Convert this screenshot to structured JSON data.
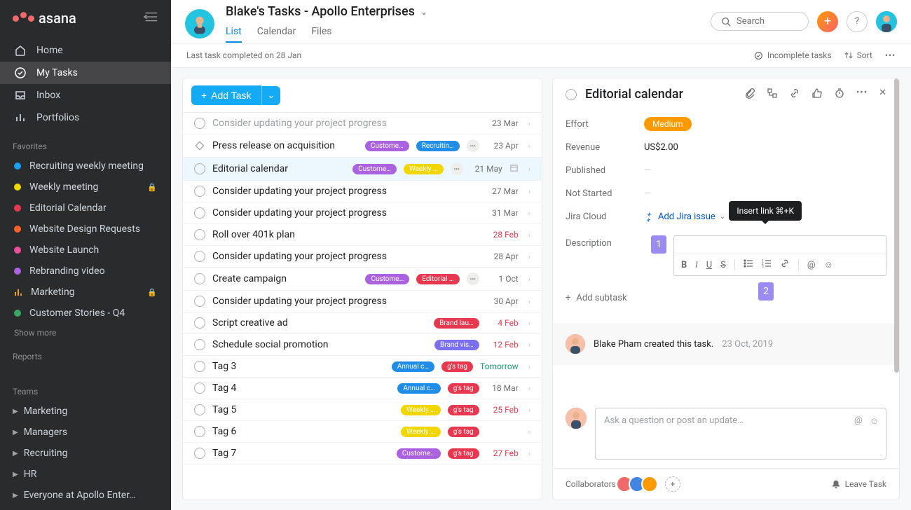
{
  "logo_text": "asana",
  "nav": [
    {
      "label": "Home",
      "icon": "home"
    },
    {
      "label": "My Tasks",
      "icon": "check",
      "active": true
    },
    {
      "label": "Inbox",
      "icon": "inbox"
    },
    {
      "label": "Portfolios",
      "icon": "bars"
    }
  ],
  "favorites_label": "Favorites",
  "favorites": [
    {
      "name": "Recruiting weekly meeting",
      "color": "#1a9ef2"
    },
    {
      "name": "Weekly meeting",
      "color": "#f2d600",
      "locked": true
    },
    {
      "name": "Editorial Calendar",
      "color": "#e8384f"
    },
    {
      "name": "Website Design Requests",
      "color": "#fd612c"
    },
    {
      "name": "Website Launch",
      "color": "#ea4e9d"
    },
    {
      "name": "Rebranding video",
      "color": "#a962e0"
    },
    {
      "name": "Marketing",
      "color": "#f2a100",
      "bars": true,
      "locked": true
    },
    {
      "name": "Customer Stories - Q4",
      "color": "#37a862"
    }
  ],
  "show_more": "Show more",
  "reports_label": "Reports",
  "teams_label": "Teams",
  "teams": [
    "Marketing",
    "Managers",
    "Recruiting",
    "HR",
    "Everyone at Apollo Enter…"
  ],
  "header": {
    "title": "Blake's Tasks - Apollo Enterprises",
    "tabs": [
      "List",
      "Calendar",
      "Files"
    ],
    "active_tab": "List",
    "search_placeholder": "Search"
  },
  "subheader": {
    "left": "Last task completed on 28 Jan",
    "incomplete": "Incomplete tasks",
    "sort": "Sort"
  },
  "add_task_label": "Add Task",
  "tasks": [
    {
      "name": "Consider updating your project progress",
      "truncated": true,
      "due": "23 Mar",
      "due_cls": "due-grey"
    },
    {
      "name": "Press release on acquisition",
      "tags": [
        {
          "t": "Custome…",
          "c": "#aa62e0"
        },
        {
          "t": "Recruitin…",
          "c": "#208ee8"
        }
      ],
      "dots": true,
      "due": "23 Apr",
      "due_cls": "due-grey",
      "milestone": true
    },
    {
      "name": "Editorial calendar",
      "tags": [
        {
          "t": "Custome…",
          "c": "#aa62e0"
        },
        {
          "t": "Weekly …",
          "c": "#f2d600"
        }
      ],
      "dots": true,
      "due": "21 May",
      "due_cls": "due-grey",
      "selected": true,
      "cal": true
    },
    {
      "name": "Consider updating your project progress",
      "due": "27 Mar",
      "due_cls": "due-grey"
    },
    {
      "name": "Consider updating your project progress",
      "due": "31 Mar",
      "due_cls": "due-grey"
    },
    {
      "name": "Roll over 401k plan",
      "due": "28 Feb",
      "due_cls": "due-red"
    },
    {
      "name": "Consider updating your project progress",
      "due": "28 Apr",
      "due_cls": "due-grey"
    },
    {
      "name": "Create campaign",
      "tags": [
        {
          "t": "Custome…",
          "c": "#aa62e0"
        },
        {
          "t": "Editorial …",
          "c": "#e8384f"
        }
      ],
      "dots": true,
      "due": "1 Oct",
      "due_cls": "due-grey"
    },
    {
      "name": "Consider updating your project progress",
      "due": "30 Apr",
      "due_cls": "due-grey"
    },
    {
      "name": "Script creative ad",
      "tags": [
        {
          "t": "Brand lau…",
          "c": "#e8384f"
        }
      ],
      "due": "4 Feb",
      "due_cls": "due-red"
    },
    {
      "name": "Schedule social promotion",
      "tags": [
        {
          "t": "Brand vis…",
          "c": "#7a6ff0"
        }
      ],
      "due": "12 Feb",
      "due_cls": "due-red"
    },
    {
      "name": "Tag 3",
      "tags": [
        {
          "t": "Annual c…",
          "c": "#208ee8"
        },
        {
          "t": "g's tag",
          "c": "#e8384f"
        }
      ],
      "due": "Tomorrow",
      "due_cls": "due-green"
    },
    {
      "name": "Tag 4",
      "tags": [
        {
          "t": "Annual c…",
          "c": "#208ee8"
        },
        {
          "t": "g's tag",
          "c": "#e8384f"
        }
      ],
      "due": "18 Mar",
      "due_cls": "due-grey"
    },
    {
      "name": "Tag 5",
      "tags": [
        {
          "t": "Weekly …",
          "c": "#f2d600"
        },
        {
          "t": "g's tag",
          "c": "#e8384f"
        }
      ],
      "due": "25 Feb",
      "due_cls": "due-red"
    },
    {
      "name": "Tag 6",
      "tags": [
        {
          "t": "Weekly …",
          "c": "#f2d600"
        },
        {
          "t": "g's tag",
          "c": "#e8384f"
        }
      ],
      "due": "",
      "due_cls": "due-grey"
    },
    {
      "name": "Tag 7",
      "tags": [
        {
          "t": "Custome…",
          "c": "#aa62e0"
        },
        {
          "t": "g's tag",
          "c": "#e8384f"
        }
      ],
      "due": "27 Feb",
      "due_cls": "due-red"
    }
  ],
  "detail": {
    "title": "Editorial calendar",
    "fields": {
      "effort": {
        "label": "Effort",
        "value": "Medium"
      },
      "revenue": {
        "label": "Revenue",
        "value": "US$2.00"
      },
      "published": {
        "label": "Published"
      },
      "not_started": {
        "label": "Not Started"
      },
      "jira": {
        "label": "Jira Cloud",
        "value": "Add Jira issue"
      },
      "description": {
        "label": "Description"
      }
    },
    "tooltip": "Insert link ⌘+K",
    "callouts": {
      "one": "1",
      "two": "2"
    },
    "add_subtask": "Add subtask",
    "activity": {
      "text": "Blake Pham created this task.",
      "date": "23 Oct, 2019"
    },
    "comment_placeholder": "Ask a question or post an update…",
    "footer": {
      "collab_label": "Collaborators",
      "leave": "Leave Task"
    },
    "collaborator_colors": [
      "#f06a6a",
      "#4186e0",
      "#fd9a00"
    ]
  }
}
